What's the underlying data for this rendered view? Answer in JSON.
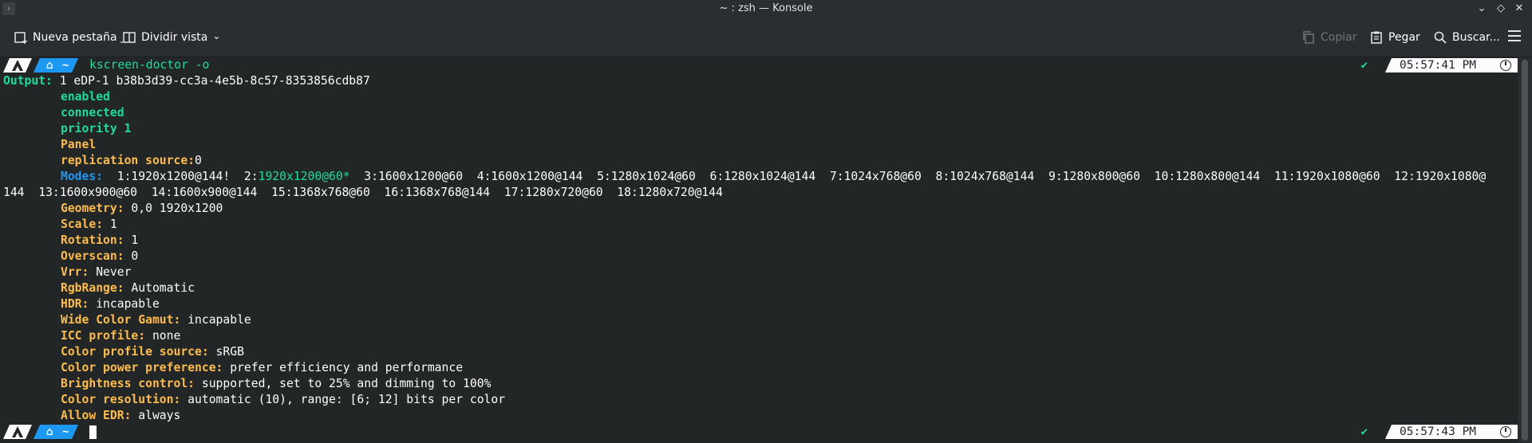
{
  "window": {
    "title": "~ : zsh — Konsole"
  },
  "toolbar": {
    "new_tab": "Nueva pestaña",
    "split_view": "Dividir vista",
    "copy": "Copiar",
    "paste": "Pegar",
    "search": "Buscar..."
  },
  "prompt1": {
    "home": "⌂",
    "path": "~",
    "command": "kscreen-doctor -o",
    "status": "✔",
    "time": "05:57:41 PM"
  },
  "prompt2": {
    "home": "⌂",
    "path": "~",
    "status": "✔",
    "time": "05:57:43 PM"
  },
  "output": {
    "header_key": "Output:",
    "header_val": " 1 eDP-1 b38b3d39-cc3a-4e5b-8c57-8353856cdb87",
    "enabled": "enabled",
    "connected": "connected",
    "priority": "priority 1",
    "panel": "Panel",
    "replication_key": "replication source:",
    "replication_val": "0",
    "modes_key": "Modes:",
    "modes_a": "  1:1920x1200@144!  2:",
    "modes_current": "1920x1200@60*",
    "modes_b": "  3:1600x1200@60  4:1600x1200@144  5:1280x1024@60  6:1280x1024@144  7:1024x768@60  8:1024x768@144  9:1280x800@60  10:1280x800@144  11:1920x1080@60  12:1920x1080@",
    "modes_wrap": "144  13:1600x900@60  14:1600x900@144  15:1368x768@60  16:1368x768@144  17:1280x720@60  18:1280x720@144",
    "props": [
      {
        "key": "Geometry:",
        "val": " 0,0 1920x1200"
      },
      {
        "key": "Scale:",
        "val": " 1"
      },
      {
        "key": "Rotation:",
        "val": " 1"
      },
      {
        "key": "Overscan:",
        "val": " 0"
      },
      {
        "key": "Vrr:",
        "val": " Never"
      },
      {
        "key": "RgbRange:",
        "val": " Automatic"
      },
      {
        "key": "HDR:",
        "val": " incapable"
      },
      {
        "key": "Wide Color Gamut:",
        "val": " incapable"
      },
      {
        "key": "ICC profile:",
        "val": " none"
      },
      {
        "key": "Color profile source:",
        "val": " sRGB"
      },
      {
        "key": "Color power preference:",
        "val": " prefer efficiency and performance"
      },
      {
        "key": "Brightness control:",
        "val": " supported, set to 25% and dimming to 100%"
      },
      {
        "key": "Color resolution:",
        "val": " automatic (10), range: [6; 12] bits per color"
      },
      {
        "key": "Allow EDR:",
        "val": " always"
      }
    ]
  }
}
